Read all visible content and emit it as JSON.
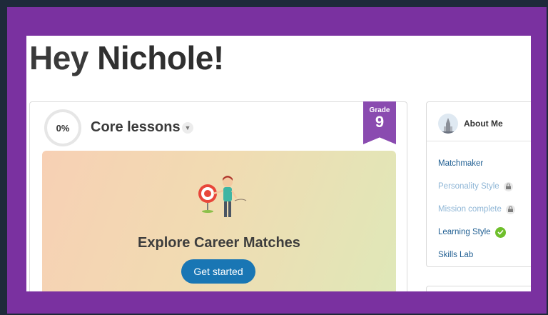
{
  "greeting": {
    "prefix": "Hey",
    "name": "Nichole!"
  },
  "core_lessons": {
    "progress": "0%",
    "title": "Core lessons",
    "grade_label": "Grade",
    "grade_number": "9"
  },
  "hero": {
    "illustration_icon": "target-person-illustration",
    "title": "Explore Career Matches",
    "button_label": "Get started"
  },
  "about_me": {
    "title": "About Me",
    "items": [
      {
        "label": "Matchmaker",
        "status": "active"
      },
      {
        "label": "Personality Style",
        "status": "locked",
        "icon": "lock-icon"
      },
      {
        "label": "Mission complete",
        "status": "locked",
        "icon": "lock-icon"
      },
      {
        "label": "Learning Style",
        "status": "complete",
        "icon": "check-icon"
      },
      {
        "label": "Skills Lab",
        "status": "active"
      }
    ]
  },
  "colors": {
    "frame": "#7a31a0",
    "grade_badge": "#8a4bb0",
    "primary_button": "#1976b4",
    "link": "#1f5e92",
    "locked_link": "#8fb6d6",
    "check": "#6fbf2c"
  }
}
